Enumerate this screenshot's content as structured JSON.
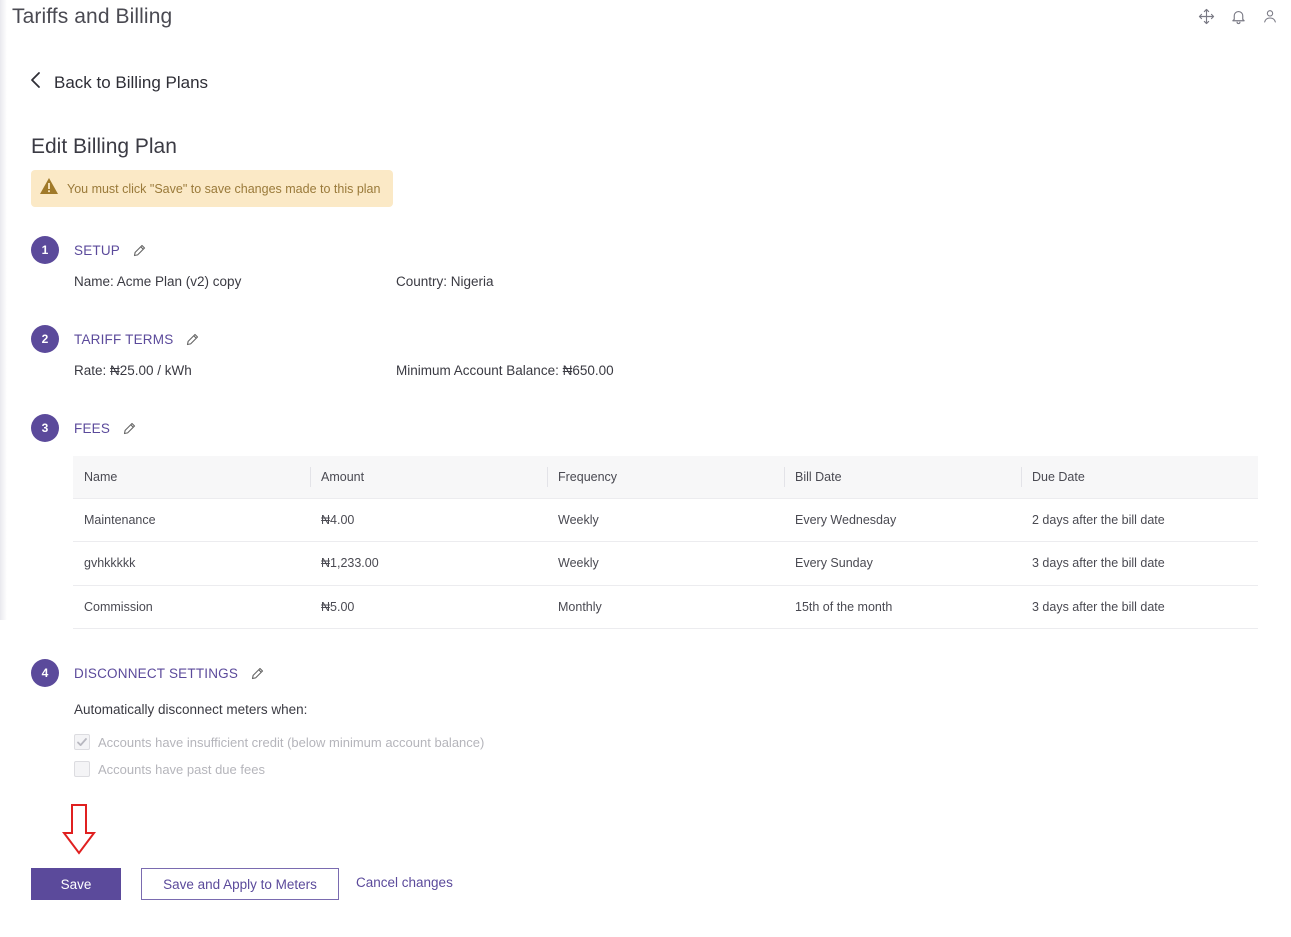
{
  "header": {
    "title": "Tariffs and Billing"
  },
  "back_link": {
    "label": "Back to Billing Plans"
  },
  "page": {
    "title": "Edit Billing Plan",
    "warning": "You must click \"Save\" to save changes made to this plan"
  },
  "steps": {
    "setup": {
      "number": "1",
      "title": "SETUP",
      "name": "Name: Acme Plan (v2) copy",
      "country": "Country: Nigeria"
    },
    "tariff": {
      "number": "2",
      "title": "TARIFF TERMS",
      "rate": "Rate: ₦25.00 / kWh",
      "min_balance": "Minimum Account Balance: ₦650.00"
    },
    "fees": {
      "number": "3",
      "title": "FEES",
      "columns": [
        "Name",
        "Amount",
        "Frequency",
        "Bill Date",
        "Due Date"
      ],
      "rows": [
        [
          "Maintenance",
          "₦4.00",
          "Weekly",
          "Every Wednesday",
          "2 days after the bill date"
        ],
        [
          "gvhkkkkk",
          "₦1,233.00",
          "Weekly",
          "Every Sunday",
          "3 days after the bill date"
        ],
        [
          "Commission",
          "₦5.00",
          "Monthly",
          "15th of the month",
          "3 days after the bill date"
        ]
      ]
    },
    "disconnect": {
      "number": "4",
      "title": "DISCONNECT SETTINGS",
      "label": "Automatically disconnect meters when:",
      "option1": "Accounts have insufficient credit (below minimum account balance)",
      "option1_checked": true,
      "option2": "Accounts have past due fees",
      "option2_checked": false
    }
  },
  "actions": {
    "save": "Save",
    "save_apply": "Save and Apply to Meters",
    "cancel": "Cancel changes"
  },
  "colors": {
    "accent": "#5b4a9b",
    "warning_bg": "#fbe9c6",
    "warning_text": "#9a7a3a",
    "annotation_arrow": "#e02020"
  },
  "icons": [
    "move-icon",
    "bell-icon",
    "user-icon",
    "chevron-left-icon",
    "warning-icon",
    "pencil-icon",
    "check-icon",
    "arrow-down-annotation-icon"
  ]
}
